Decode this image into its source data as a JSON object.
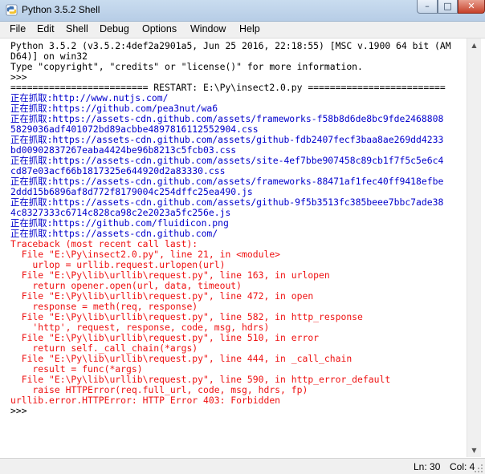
{
  "window": {
    "title": "Python 3.5.2 Shell"
  },
  "titlebar_buttons": {
    "minimize": "–",
    "maximize": "□",
    "close": "✕"
  },
  "menu": [
    "File",
    "Edit",
    "Shell",
    "Debug",
    "Options",
    "Window",
    "Help"
  ],
  "colors": {
    "normal": "#000000",
    "output": "#0000cc",
    "error": "#ee1111"
  },
  "shell_lines": [
    {
      "text": "Python 3.5.2 (v3.5.2:4def2a2901a5, Jun 25 2016, 22:18:55) [MSC v.1900 64 bit (AM",
      "style": "normal"
    },
    {
      "text": "D64)] on win32",
      "style": "normal"
    },
    {
      "text": "Type \"copyright\", \"credits\" or \"license()\" for more information.",
      "style": "normal"
    },
    {
      "text": ">>> ",
      "style": "normal"
    },
    {
      "text": "========================= RESTART: E:\\Py\\insect2.0.py =========================",
      "style": "normal"
    },
    {
      "text": "正在抓取:http://www.nutjs.com/",
      "style": "output"
    },
    {
      "text": "正在抓取:https://github.com/pea3nut/wa6",
      "style": "output"
    },
    {
      "text": "正在抓取:https://assets-cdn.github.com/assets/frameworks-f58b8d6de8bc9fde2468808",
      "style": "output"
    },
    {
      "text": "5829036adf401072bd89acbbe4897816112552904.css",
      "style": "output"
    },
    {
      "text": "正在抓取:https://assets-cdn.github.com/assets/github-fdb2407fecf3baa8ae269dd4233",
      "style": "output"
    },
    {
      "text": "bd00902837267eaba4424be96b8213c5fcb03.css",
      "style": "output"
    },
    {
      "text": "正在抓取:https://assets-cdn.github.com/assets/site-4ef7bbe907458c89cb1f7f5c5e6c4",
      "style": "output"
    },
    {
      "text": "cd87e03acf66b1817325e644920d2a83330.css",
      "style": "output"
    },
    {
      "text": "正在抓取:https://assets-cdn.github.com/assets/frameworks-88471af1fec40ff9418efbe",
      "style": "output"
    },
    {
      "text": "2ddd15b6896af8d772f8179004c254dffc25ea490.js",
      "style": "output"
    },
    {
      "text": "正在抓取:https://assets-cdn.github.com/assets/github-9f5b3513fc385beee7bbc7ade38",
      "style": "output"
    },
    {
      "text": "4c8327333c6714c828ca98c2e2023a5fc256e.js",
      "style": "output"
    },
    {
      "text": "正在抓取:https://github.com/fluidicon.png",
      "style": "output"
    },
    {
      "text": "正在抓取:https://assets-cdn.github.com/",
      "style": "output"
    },
    {
      "text": "Traceback (most recent call last):",
      "style": "error"
    },
    {
      "text": "  File \"E:\\Py\\insect2.0.py\", line 21, in <module>",
      "style": "error"
    },
    {
      "text": "    urlop = urllib.request.urlopen(url)",
      "style": "error"
    },
    {
      "text": "  File \"E:\\Py\\lib\\urllib\\request.py\", line 163, in urlopen",
      "style": "error"
    },
    {
      "text": "    return opener.open(url, data, timeout)",
      "style": "error"
    },
    {
      "text": "  File \"E:\\Py\\lib\\urllib\\request.py\", line 472, in open",
      "style": "error"
    },
    {
      "text": "    response = meth(req, response)",
      "style": "error"
    },
    {
      "text": "  File \"E:\\Py\\lib\\urllib\\request.py\", line 582, in http_response",
      "style": "error"
    },
    {
      "text": "    'http', request, response, code, msg, hdrs)",
      "style": "error"
    },
    {
      "text": "  File \"E:\\Py\\lib\\urllib\\request.py\", line 510, in error",
      "style": "error"
    },
    {
      "text": "    return self._call_chain(*args)",
      "style": "error"
    },
    {
      "text": "  File \"E:\\Py\\lib\\urllib\\request.py\", line 444, in _call_chain",
      "style": "error"
    },
    {
      "text": "    result = func(*args)",
      "style": "error"
    },
    {
      "text": "  File \"E:\\Py\\lib\\urllib\\request.py\", line 590, in http_error_default",
      "style": "error"
    },
    {
      "text": "    raise HTTPError(req.full_url, code, msg, hdrs, fp)",
      "style": "error"
    },
    {
      "text": "urllib.error.HTTPError: HTTP Error 403: Forbidden",
      "style": "error"
    },
    {
      "text": ">>> ",
      "style": "normal"
    }
  ],
  "status": {
    "line": "Ln: 30",
    "column": "Col: 4"
  }
}
